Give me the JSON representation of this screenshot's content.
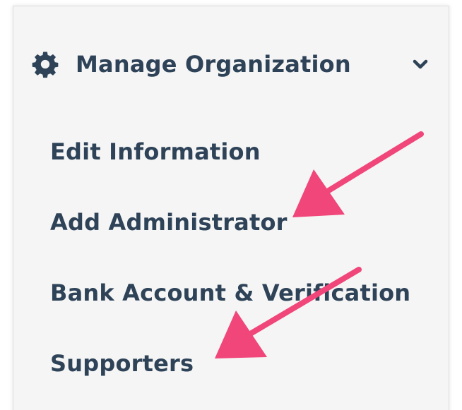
{
  "menu": {
    "header": {
      "icon": "gear-icon",
      "title": "Manage Organization",
      "toggle_icon": "chevron-down-icon"
    },
    "items": [
      {
        "label": "Edit Information"
      },
      {
        "label": "Add Administrator"
      },
      {
        "label": "Bank Account & Verification"
      },
      {
        "label": "Supporters"
      }
    ]
  },
  "colors": {
    "text": "#2e4358",
    "panel_background": "#f5f5f5",
    "annotation_arrow": "#f0467a"
  }
}
